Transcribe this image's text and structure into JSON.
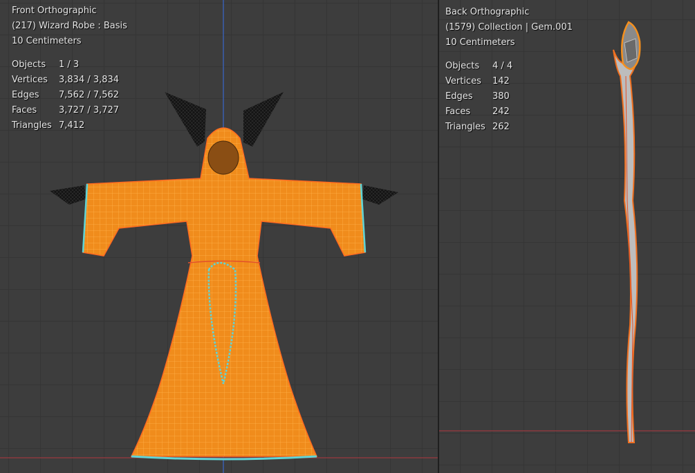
{
  "left_viewport": {
    "view_name": "Front Orthographic",
    "object_info": "(217) Wizard Robe : Basis",
    "scale": "10 Centimeters",
    "stats": [
      {
        "label": "Objects",
        "value": "1 / 3"
      },
      {
        "label": "Vertices",
        "value": "3,834 / 3,834"
      },
      {
        "label": "Edges",
        "value": "7,562 / 7,562"
      },
      {
        "label": "Faces",
        "value": "3,727 / 3,727"
      },
      {
        "label": "Triangles",
        "value": "7,412"
      }
    ]
  },
  "right_viewport": {
    "view_name": "Back Orthographic",
    "object_info": "(1579) Collection | Gem.001",
    "scale": "10 Centimeters",
    "stats": [
      {
        "label": "Objects",
        "value": "4 / 4"
      },
      {
        "label": "Vertices",
        "value": "142"
      },
      {
        "label": "Edges",
        "value": "380"
      },
      {
        "label": "Faces",
        "value": "242"
      },
      {
        "label": "Triangles",
        "value": "262"
      }
    ]
  },
  "colors": {
    "background": "#3d3d3d",
    "grid": "#353535",
    "selected_mesh": "#f5901e",
    "seam": "#5fd4d6",
    "x_axis": "#8b3a3f",
    "z_axis": "#3a5fb0",
    "unselected_mesh": "#1e1e1e"
  }
}
